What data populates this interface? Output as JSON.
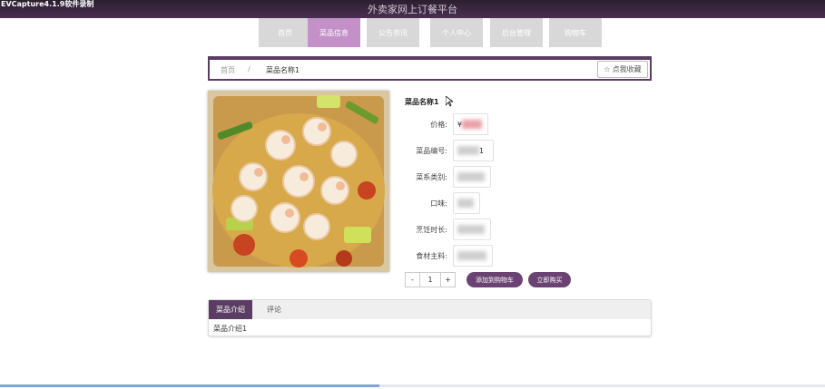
{
  "recorder": "EVCapture4.1.9软件录制",
  "site_title": "外卖家网上订餐平台",
  "nav": [
    "首页",
    "菜品信息",
    "公告资讯",
    "个人中心",
    "后台管理",
    "购物车"
  ],
  "nav_active": "菜品信息",
  "breadcrumb": {
    "home": "首页",
    "sep": "/",
    "current": "菜品名称1"
  },
  "favorite_label": "点我收藏",
  "product": {
    "name": "菜品名称1",
    "fields": [
      {
        "label": "价格:",
        "value": "¥"
      },
      {
        "label": "菜品编号:",
        "value": "1"
      },
      {
        "label": "菜系类别:",
        "value": ""
      },
      {
        "label": "口味:",
        "value": ""
      },
      {
        "label": "烹饪时长:",
        "value": ""
      },
      {
        "label": "食材主料:",
        "value": ""
      }
    ]
  },
  "quantity": {
    "minus": "-",
    "value": "1",
    "plus": "+"
  },
  "buttons": {
    "add_cart": "添加到购物车",
    "buy_now": "立即购买"
  },
  "tabs": [
    "菜品介绍",
    "评论"
  ],
  "tab_content": "菜品介绍1",
  "progress": 0.46,
  "colors": {
    "accent": "#5b3d63",
    "nav_active": "#c391c8",
    "button": "#6a4372"
  }
}
